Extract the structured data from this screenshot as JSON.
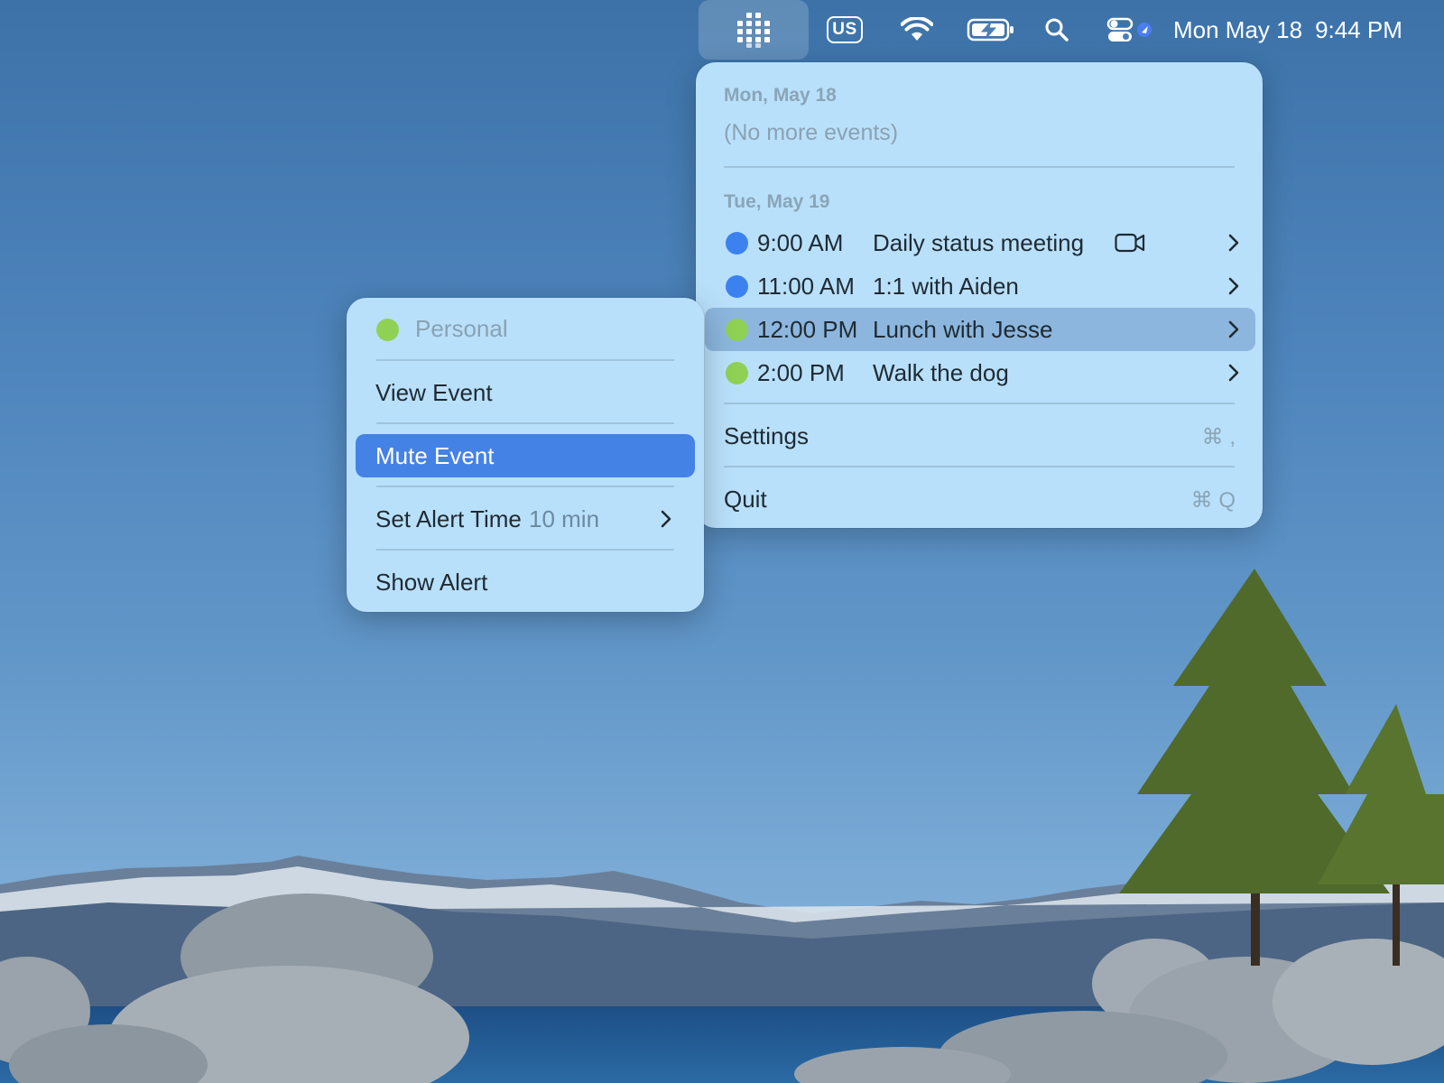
{
  "menubar": {
    "app_icon": "calendar-grid-icon",
    "keyboard_input": "US",
    "wifi_icon": "wifi-icon",
    "battery_icon": "battery-charging-icon",
    "search_icon": "search-icon",
    "control_center_icon": "control-center-icon",
    "date": "Mon May 18",
    "time": "9:44 PM"
  },
  "menu": {
    "today": {
      "header": "Mon, May 18",
      "empty_text": "(No more events)"
    },
    "tomorrow": {
      "header": "Tue, May 19",
      "events": [
        {
          "time": "9:00 AM",
          "title": "Daily status meeting",
          "calendar_color": "#3b82f0",
          "has_video": true
        },
        {
          "time": "11:00 AM",
          "title": "1:1 with Aiden",
          "calendar_color": "#3b82f0",
          "has_video": false
        },
        {
          "time": "12:00 PM",
          "title": "Lunch with Jesse",
          "calendar_color": "#8fd154",
          "has_video": false,
          "selected": true
        },
        {
          "time": "2:00 PM",
          "title": "Walk the dog",
          "calendar_color": "#8fd154",
          "has_video": false
        }
      ]
    },
    "settings": {
      "label": "Settings",
      "shortcut": "⌘ ,"
    },
    "quit": {
      "label": "Quit",
      "shortcut": "⌘ Q"
    }
  },
  "submenu": {
    "calendar_name": "Personal",
    "calendar_color": "#8fd154",
    "view_event": "View Event",
    "mute_event": "Mute Event",
    "set_alert_time": "Set Alert Time",
    "alert_time_value": "10 min",
    "show_alert": "Show Alert"
  },
  "colors": {
    "menu_bg": "#b9e0fa",
    "selected_row": "#8cb6dd",
    "accent": "#4582e6"
  }
}
